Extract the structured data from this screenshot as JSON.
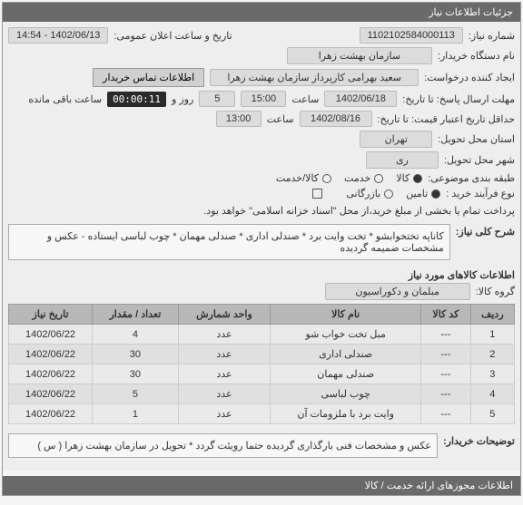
{
  "header": {
    "title": "جزئیات اطلاعات نیاز"
  },
  "form": {
    "need_no_label": "شماره نیاز:",
    "need_no": "1102102584000113",
    "pub_date_label": "تاریخ و ساعت اعلان عمومی:",
    "pub_date": "1402/06/13 - 14:54",
    "buyer_org_label": "نام دستگاه خریدار:",
    "buyer_org": "سازمان بهشت زهرا",
    "requester_label": "ایجاد کننده درخواست:",
    "requester": "سعید بهرامی کارپرداز سازمان بهشت زهرا",
    "contact_btn": "اطلاعات تماس خریدار",
    "deadline_label": "مهلت ارسال پاسخ: تا تاریخ:",
    "deadline_date": "1402/06/18",
    "time_label": "ساعت",
    "deadline_time": "15:00",
    "days_label": "روز و",
    "days": "5",
    "remain_label": "ساعت باقی مانده",
    "countdown": "00:00:11",
    "validity_label": "حداقل تاریخ اعتبار قیمت: تا تاریخ:",
    "validity_date": "1402/08/16",
    "validity_time": "13:00",
    "delivery_prov_label": "استان محل تحویل:",
    "delivery_prov": "تهران",
    "delivery_city_label": "شهر محل تحویل:",
    "delivery_city": "ری",
    "category_label": "طبقه بندی موضوعی:",
    "cat_goods": "کالا",
    "cat_service": "خدمت",
    "cat_goods_service": "کالا/خدمت",
    "process_label": "نوع فرآیند خرید :",
    "process_full": "تامین",
    "process_partial": "بازرگانی",
    "payment_note": "پرداخت تمام یا بخشی از مبلغ خرید،از محل \"اسناد خزانه اسلامی\" خواهد بود."
  },
  "need_desc": {
    "label": "شرح کلی نیاز:",
    "text": "کاناپه تختخوابشو * تخت وایت برد * صندلی اداری * صندلی مهمان * چوب لباسی ایستاده - عکس و مشخصات ضمیمه گردیده"
  },
  "goods_section": {
    "title": "اطلاعات کالاهای مورد نیاز",
    "group_label": "گروه کالا:",
    "group_value": "مبلمان و دکوراسیون"
  },
  "table": {
    "headers": [
      "ردیف",
      "کد کالا",
      "نام کالا",
      "واحد شمارش",
      "تعداد / مقدار",
      "تاریخ نیاز"
    ],
    "rows": [
      {
        "n": "1",
        "code": "---",
        "name": "مبل تخت خواب شو",
        "unit": "عدد",
        "qty": "4",
        "date": "1402/06/22"
      },
      {
        "n": "2",
        "code": "---",
        "name": "صندلی اداری",
        "unit": "عدد",
        "qty": "30",
        "date": "1402/06/22"
      },
      {
        "n": "3",
        "code": "---",
        "name": "صندلی مهمان",
        "unit": "عدد",
        "qty": "30",
        "date": "1402/06/22"
      },
      {
        "n": "4",
        "code": "---",
        "name": "چوب لباسی",
        "unit": "عدد",
        "qty": "5",
        "date": "1402/06/22"
      },
      {
        "n": "5",
        "code": "---",
        "name": "وایت برد با ملزومات آن",
        "unit": "عدد",
        "qty": "1",
        "date": "1402/06/22"
      }
    ]
  },
  "buyer_note": {
    "label": "توضیحات خریدار:",
    "text": "عکس و مشخصات فنی بارگذاری گردیده حتما رویئت گردد * تحویل در سازمان بهشت زهرا ( س )"
  },
  "footer": {
    "title": "اطلاعات مجوزهای ارائه خدمت / کالا"
  }
}
